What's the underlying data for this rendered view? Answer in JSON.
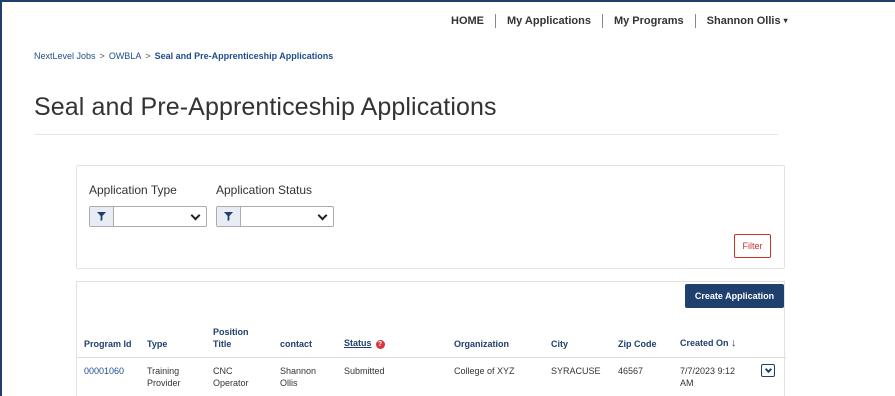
{
  "topnav": {
    "home": "HOME",
    "my_applications": "My Applications",
    "my_programs": "My Programs",
    "user": "Shannon Ollis",
    "user_caret": "▾"
  },
  "breadcrumb": {
    "root": "NextLevel Jobs",
    "section": "OWBLA",
    "current": "Seal and Pre-Apprenticeship Applications",
    "separator": ">"
  },
  "page_title": "Seal and Pre-Apprenticeship Applications",
  "filters": {
    "application_type_label": "Application Type",
    "application_status_label": "Application Status",
    "application_type_value": "",
    "application_status_value": "",
    "filter_button": "Filter"
  },
  "table": {
    "create_button": "Create Application",
    "headers": {
      "program_id": "Program Id",
      "type": "Type",
      "position_title_1": "Position",
      "position_title_2": "Title",
      "contact": "contact",
      "status": "Status",
      "status_help": "?",
      "organization": "Organization",
      "city": "City",
      "zip": "Zip Code",
      "created_on": "Created On",
      "sort_arrow": "↓"
    },
    "rows": [
      {
        "program_id": "00001060",
        "type_1": "Training",
        "type_2": "Provider",
        "position_1": "CNC",
        "position_2": "Operator",
        "contact_1": "Shannon",
        "contact_2": "Ollis",
        "status": "Submitted",
        "organization": "College of XYZ",
        "city": "SYRACUSE",
        "zip": "46567",
        "created_1": "7/7/2023 9:12",
        "created_2": "AM"
      }
    ]
  }
}
